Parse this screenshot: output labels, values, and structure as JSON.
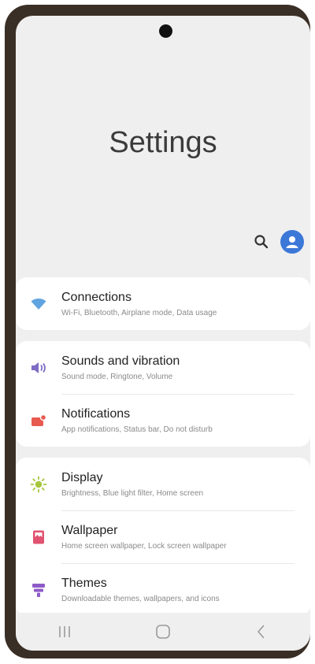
{
  "header": {
    "title": "Settings"
  },
  "icons": {
    "search": "search-icon",
    "account": "account-icon"
  },
  "groups": [
    {
      "items": [
        {
          "icon": "wifi-icon",
          "title": "Connections",
          "subtitle": "Wi-Fi, Bluetooth, Airplane mode, Data usage",
          "color": "#5fa3e0"
        }
      ]
    },
    {
      "items": [
        {
          "icon": "volume-icon",
          "title": "Sounds and vibration",
          "subtitle": "Sound mode, Ringtone, Volume",
          "color": "#7e6bc4"
        },
        {
          "icon": "notification-icon",
          "title": "Notifications",
          "subtitle": "App notifications, Status bar, Do not disturb",
          "color": "#e85a4f"
        }
      ]
    },
    {
      "items": [
        {
          "icon": "brightness-icon",
          "title": "Display",
          "subtitle": "Brightness, Blue light filter, Home screen",
          "color": "#a6c63c"
        },
        {
          "icon": "wallpaper-icon",
          "title": "Wallpaper",
          "subtitle": "Home screen wallpaper, Lock screen wallpaper",
          "color": "#e0526f"
        },
        {
          "icon": "themes-icon",
          "title": "Themes",
          "subtitle": "Downloadable themes, wallpapers, and icons",
          "color": "#8e5bc8"
        }
      ]
    }
  ],
  "navbar": {
    "recents": "recents-icon",
    "home": "home-icon",
    "back": "back-icon"
  },
  "colors": {
    "accent": "#3c78d8",
    "background": "#efefef",
    "card": "#ffffff"
  }
}
